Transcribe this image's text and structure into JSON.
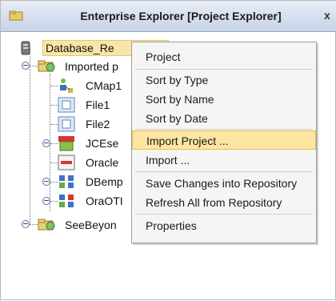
{
  "window": {
    "title": "Enterprise Explorer [Project Explorer]",
    "close_glyph": "x",
    "accent": "#f7e6a8"
  },
  "tree": {
    "root_label": "Database_Re",
    "items": [
      {
        "label": "Imported p",
        "icon": "project-folder-icon"
      },
      {
        "label": "CMap1",
        "icon": "connectivity-map-icon"
      },
      {
        "label": "File1",
        "icon": "file-icon"
      },
      {
        "label": "File2",
        "icon": "file-icon"
      },
      {
        "label": "JCEse",
        "icon": "jar-icon"
      },
      {
        "label": "Oracle",
        "icon": "oracle-icon"
      },
      {
        "label": "DBemp",
        "icon": "dbemp-icon"
      },
      {
        "label": "OraOTI",
        "icon": "oraoti-icon"
      },
      {
        "label": "SeeBeyon",
        "icon": "project-folder-icon"
      }
    ]
  },
  "context_menu": {
    "items": [
      {
        "label": "Project"
      },
      {
        "label": "Sort by Type"
      },
      {
        "label": "Sort by Name"
      },
      {
        "label": "Sort by Date"
      },
      {
        "label": "Import Project ..."
      },
      {
        "label": "Import ..."
      },
      {
        "label": "Save Changes into Repository"
      },
      {
        "label": "Refresh All from Repository"
      },
      {
        "label": "Properties"
      }
    ],
    "highlighted_index": 4
  }
}
